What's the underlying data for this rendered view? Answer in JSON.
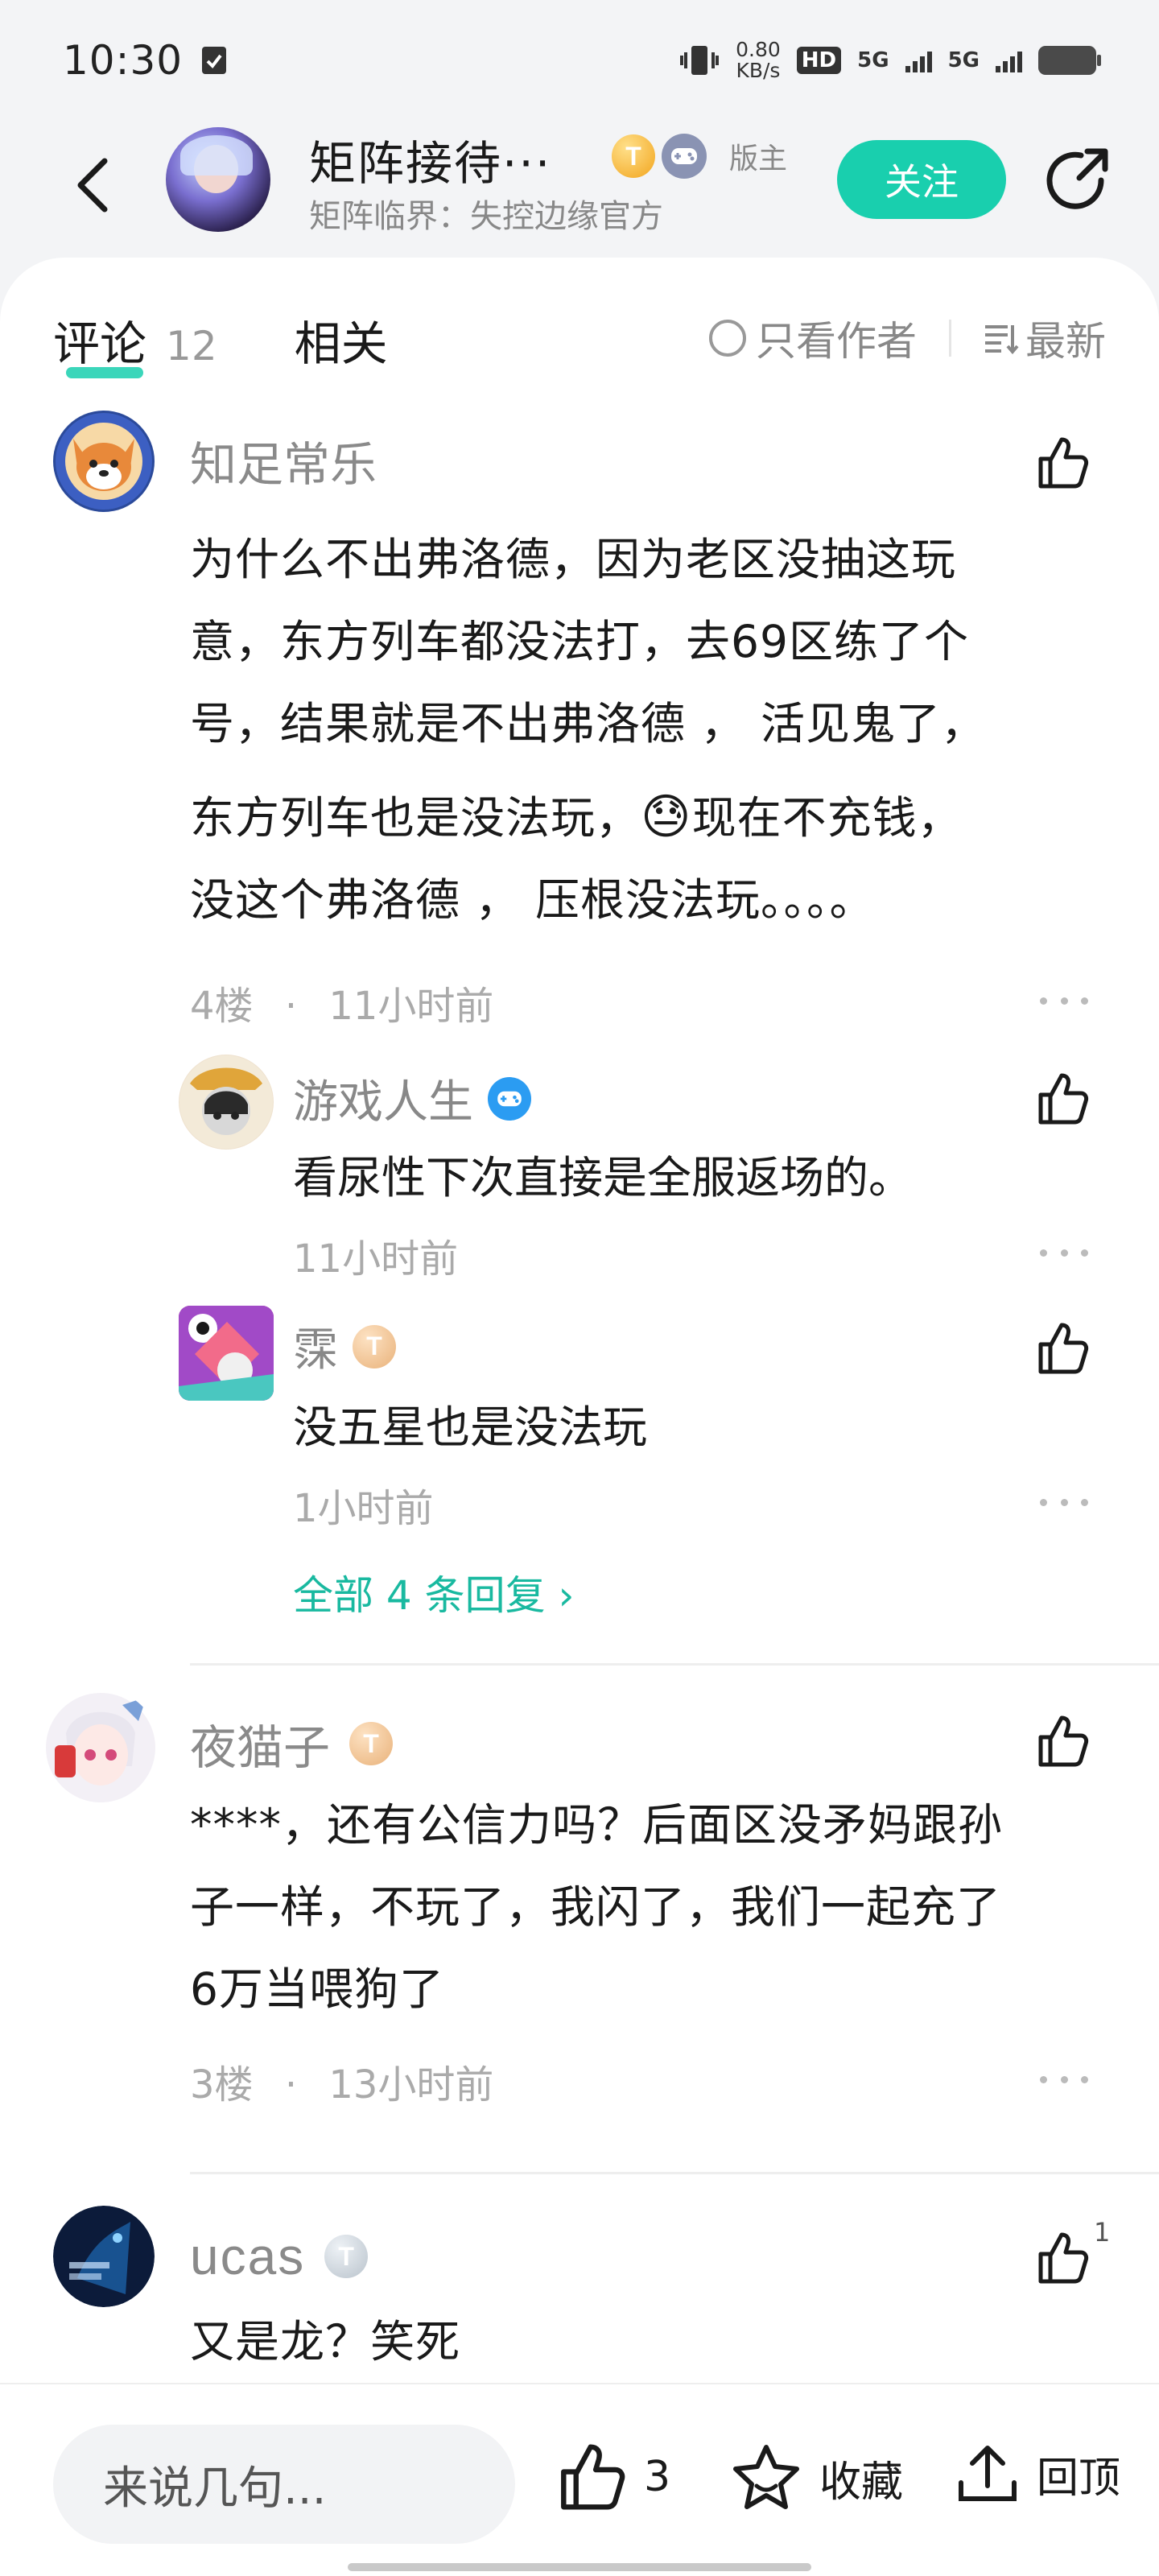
{
  "status_bar": {
    "time": "10:30",
    "net_speed_value": "0.80",
    "net_speed_unit": "KB/s",
    "hd_label": "HD",
    "network_1": "5G",
    "network_2": "5G"
  },
  "header": {
    "title": "矩阵接待···",
    "subtitle": "矩阵临界：失控边缘官方",
    "mod_label": "版主",
    "follow_label": "关注",
    "badge_letter": "T"
  },
  "tabs": {
    "comments_label": "评论",
    "comments_count": "12",
    "related_label": "相关",
    "author_only_label": "只看作者",
    "sort_label": "最新"
  },
  "comments": [
    {
      "user": "知足常乐",
      "lines": [
        "为什么不出弗洛德，因为老区没抽这玩",
        "意，东方列车都没法打，去69区练了个",
        "号，结果就是不出弗洛德 ， 活见鬼了，",
        "东方列车也是没法玩，",
        "现在不充钱，",
        "没这个弗洛德 ， 压根没法玩。。。。"
      ],
      "emoji": "😓",
      "floor": "4楼",
      "time": "11小时前",
      "replies": [
        {
          "user": "游戏人生",
          "text": "看尿性下次直接是全服返场的。",
          "time": "11小时前"
        },
        {
          "user": "霂",
          "badge_letter": "T",
          "text": "没五星也是没法玩",
          "time": "1小时前"
        }
      ],
      "all_replies_label": "全部 4 条回复 ›"
    },
    {
      "user": "夜猫子",
      "badge_letter": "T",
      "lines": [
        "****，还有公信力吗？后面区没矛妈跟孙",
        "子一样，不玩了，我闪了，我们一起充了",
        "6万当喂狗了"
      ],
      "floor": "3楼",
      "time": "13小时前"
    },
    {
      "user": "ucas",
      "badge_letter": "T",
      "lines": [
        "又是龙？笑死"
      ],
      "like_count": "1"
    }
  ],
  "bottom_bar": {
    "input_placeholder": "来说几句...",
    "like_count": "3",
    "collect_label": "收藏",
    "top_label": "回顶"
  },
  "colors": {
    "accent": "#19cfae",
    "link": "#19b9a0",
    "muted": "#8a8a8a"
  }
}
